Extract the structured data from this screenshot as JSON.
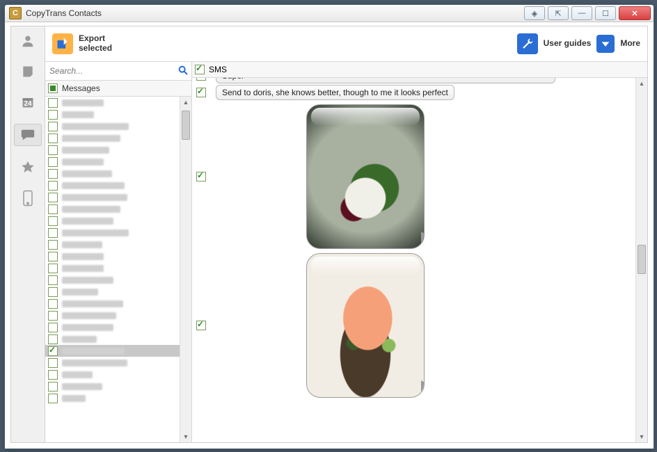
{
  "app": {
    "title": "CopyTrans Contacts",
    "icon_letter": "C"
  },
  "window_controls": [
    "help-icon",
    "restore-icon",
    "minimize-icon",
    "maximize-icon",
    "close-icon"
  ],
  "toolbar": {
    "export_line1": "Export",
    "export_line2": "selected",
    "user_guides": "User guides",
    "more": "More"
  },
  "rail": {
    "items": [
      "contacts",
      "notes",
      "calendar",
      "messages",
      "bookmarks",
      "device"
    ],
    "calendar_day": "24",
    "active": "messages"
  },
  "search": {
    "placeholder": "Search..."
  },
  "sidebar": {
    "header": "Messages",
    "contacts_count": 26,
    "selected_index": 21,
    "name_widths": [
      60,
      46,
      96,
      84,
      68,
      60,
      72,
      90,
      94,
      84,
      74,
      96,
      58,
      60,
      60,
      74,
      52,
      88,
      78,
      74,
      50,
      90,
      94,
      44,
      58,
      34
    ]
  },
  "sms": {
    "label": "SMS"
  },
  "messages": [
    {
      "type": "text",
      "text": "Super",
      "truncated": true
    },
    {
      "type": "text",
      "text": "Send to doris, she knows better, though to me it looks perfect"
    },
    {
      "type": "image",
      "img": "food1"
    },
    {
      "type": "image",
      "img": "food2"
    }
  ]
}
